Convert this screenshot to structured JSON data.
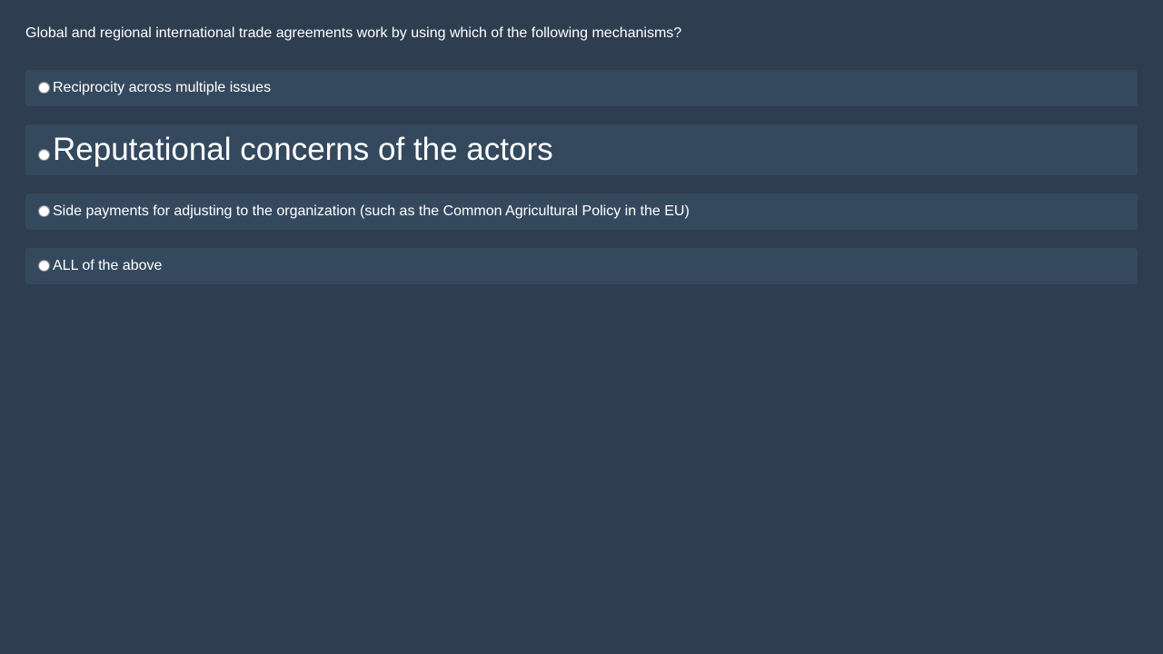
{
  "question": {
    "text": "Global and regional international trade agreements work by using which of the following mechanisms?"
  },
  "options": [
    {
      "label": "Reciprocity across multiple issues",
      "selected": false
    },
    {
      "label": "Reputational concerns of the actors",
      "selected": false
    },
    {
      "label": "Side payments for adjusting to the organization (such as the Common Agricultural Policy in the EU)",
      "selected": false
    },
    {
      "label": "ALL of the above",
      "selected": false
    }
  ],
  "colors": {
    "background": "#2e3d4f",
    "option_background": "#34495e",
    "text": "#ffffff"
  }
}
